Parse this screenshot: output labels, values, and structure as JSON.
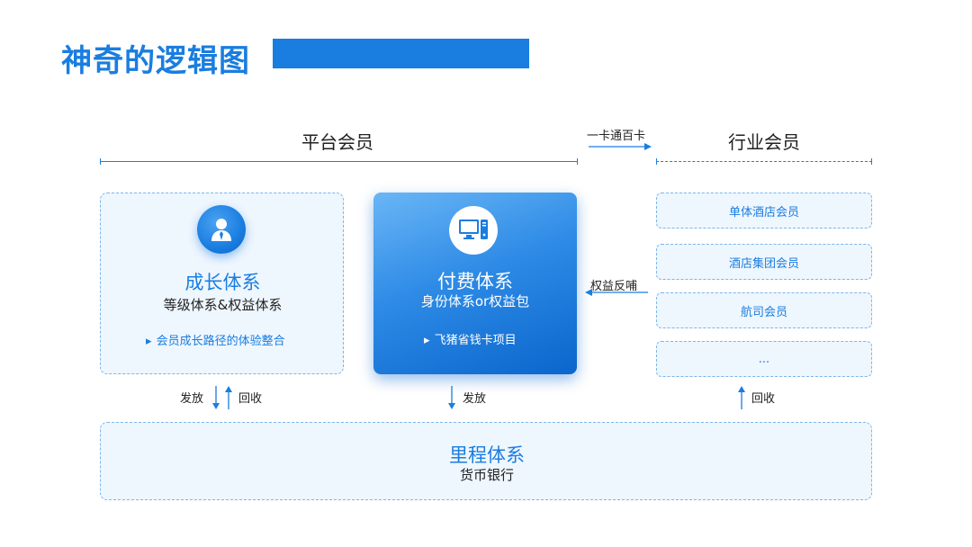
{
  "header": {
    "title": "神奇的逻辑图",
    "accent_color": "#1a7de0"
  },
  "platform": {
    "heading": "平台会员"
  },
  "connector_top": {
    "label": "一卡通百卡"
  },
  "industry": {
    "heading": "行业会员",
    "items": [
      {
        "label": "单体酒店会员"
      },
      {
        "label": "酒店集团会员"
      },
      {
        "label": "航司会员"
      },
      {
        "label": "..."
      }
    ]
  },
  "growth_card": {
    "icon": "user-icon",
    "title": "成长体系",
    "subtitle": "等级体系&权益体系",
    "bullet_marker": "▸",
    "bullet": "会员成长路径的体验整合"
  },
  "paid_card": {
    "icon": "computer-icon",
    "title": "付费体系",
    "subtitle": "身份体系or权益包",
    "bullet_marker": "▸",
    "bullet": "飞猪省钱卡项目"
  },
  "connector_middle": {
    "label": "权益反哺"
  },
  "flows": {
    "growth_issue": "发放",
    "growth_recover": "回收",
    "paid_issue": "发放",
    "industry_recover": "回收"
  },
  "mileage": {
    "title": "里程体系",
    "subtitle": "货币银行"
  }
}
